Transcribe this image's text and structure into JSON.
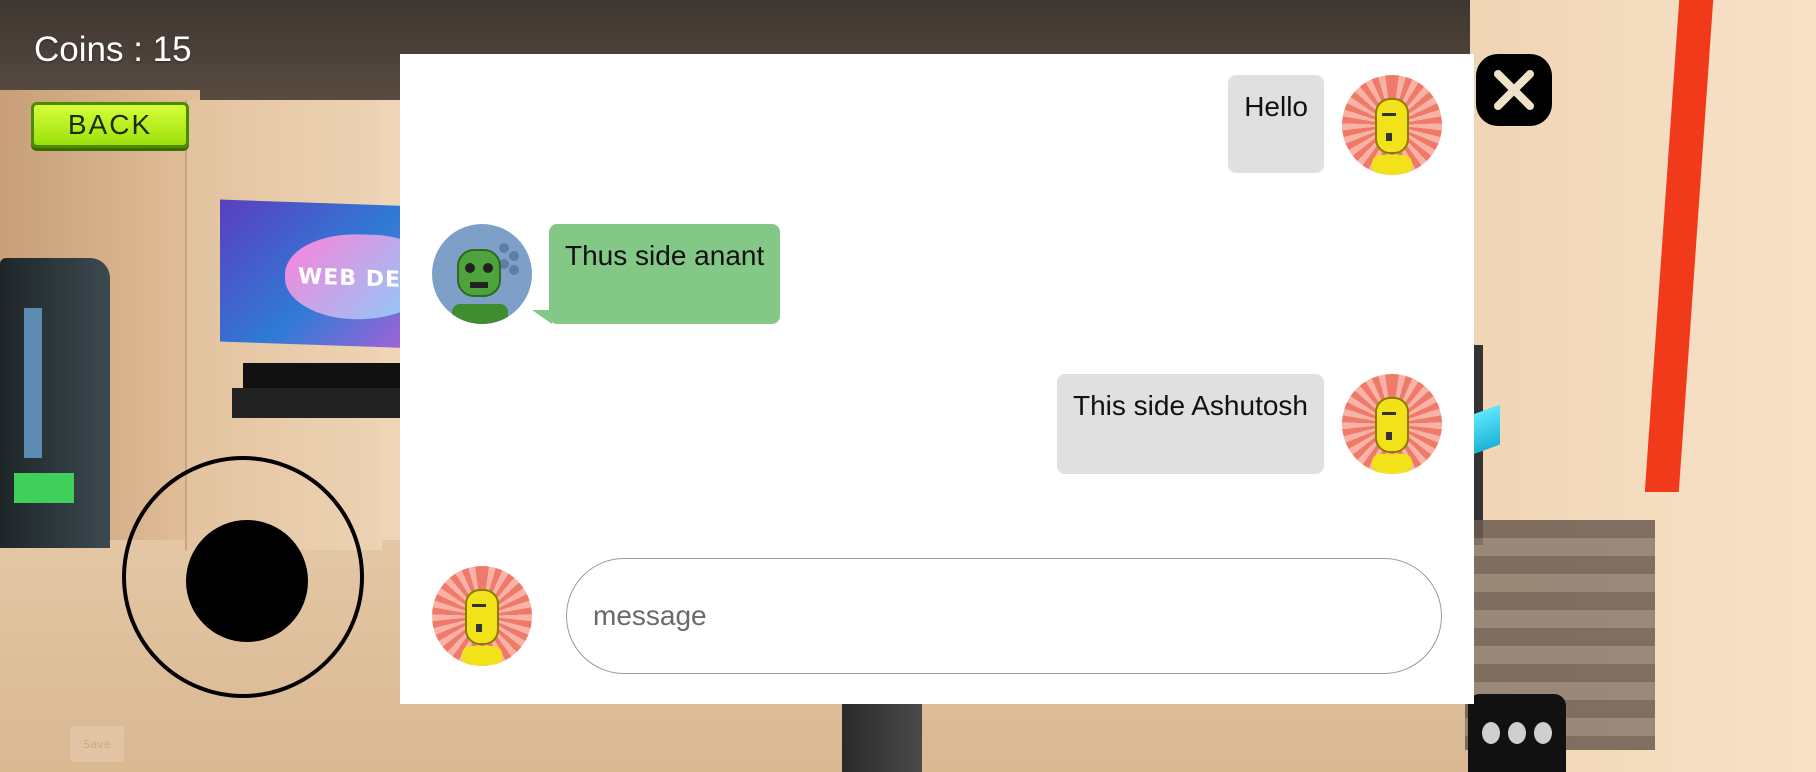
{
  "hud": {
    "coins_text": "Coins : 15",
    "back_label": "BACK",
    "save_label": "Save"
  },
  "scene": {
    "tv_text": "WEB DE"
  },
  "chat": {
    "messages": [
      {
        "sender": "self",
        "text": "Hello"
      },
      {
        "sender": "other",
        "text": "Thus side anant"
      },
      {
        "sender": "self",
        "text": "This side Ashutosh"
      }
    ],
    "input_placeholder": "message",
    "input_value": ""
  },
  "colors": {
    "outgoing_bubble": "#e0e0e0",
    "incoming_bubble": "#83c886",
    "back_button": "#b6f21c",
    "red_pole": "#f03a1a"
  },
  "icons": {
    "close": "close-icon",
    "more": "more-dots-icon"
  }
}
